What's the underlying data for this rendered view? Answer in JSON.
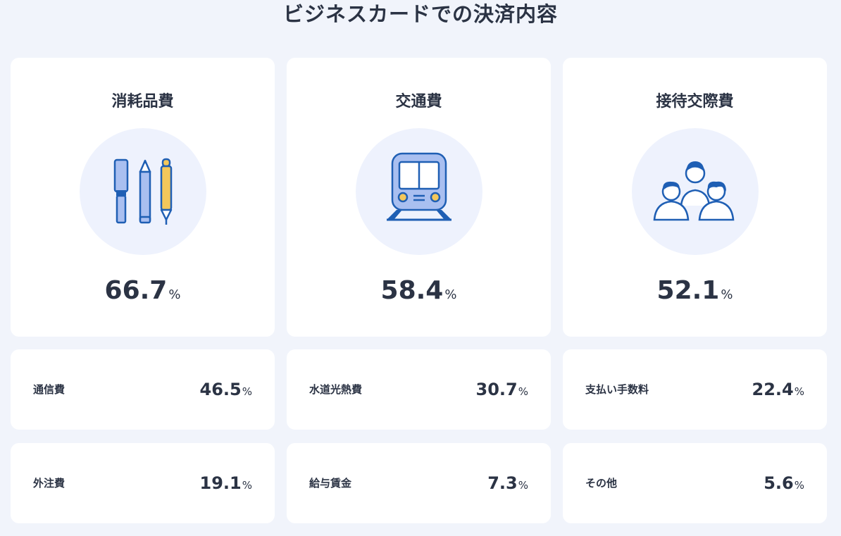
{
  "title": "ビジネスカードでの決済内容",
  "unit": "%",
  "featured": [
    {
      "label": "消耗品費",
      "icon": "stationery-icon",
      "value": "66.7"
    },
    {
      "label": "交通費",
      "icon": "train-icon",
      "value": "58.4"
    },
    {
      "label": "接待交際費",
      "icon": "people-icon",
      "value": "52.1"
    }
  ],
  "others": [
    {
      "label": "通信費",
      "value": "46.5"
    },
    {
      "label": "水道光熱費",
      "value": "30.7"
    },
    {
      "label": "支払い手数料",
      "value": "22.4"
    },
    {
      "label": "外注費",
      "value": "19.1"
    },
    {
      "label": "給与賃金",
      "value": "7.3"
    },
    {
      "label": "その他",
      "value": "5.6"
    }
  ],
  "colors": {
    "background": "#f1f4fb",
    "card": "#ffffff",
    "icon_circle": "#eef2fd",
    "icon_blue": "#1f5fb4",
    "icon_light_blue": "#a9bff0",
    "icon_yellow": "#f3c75a",
    "text": "#2b3344"
  }
}
